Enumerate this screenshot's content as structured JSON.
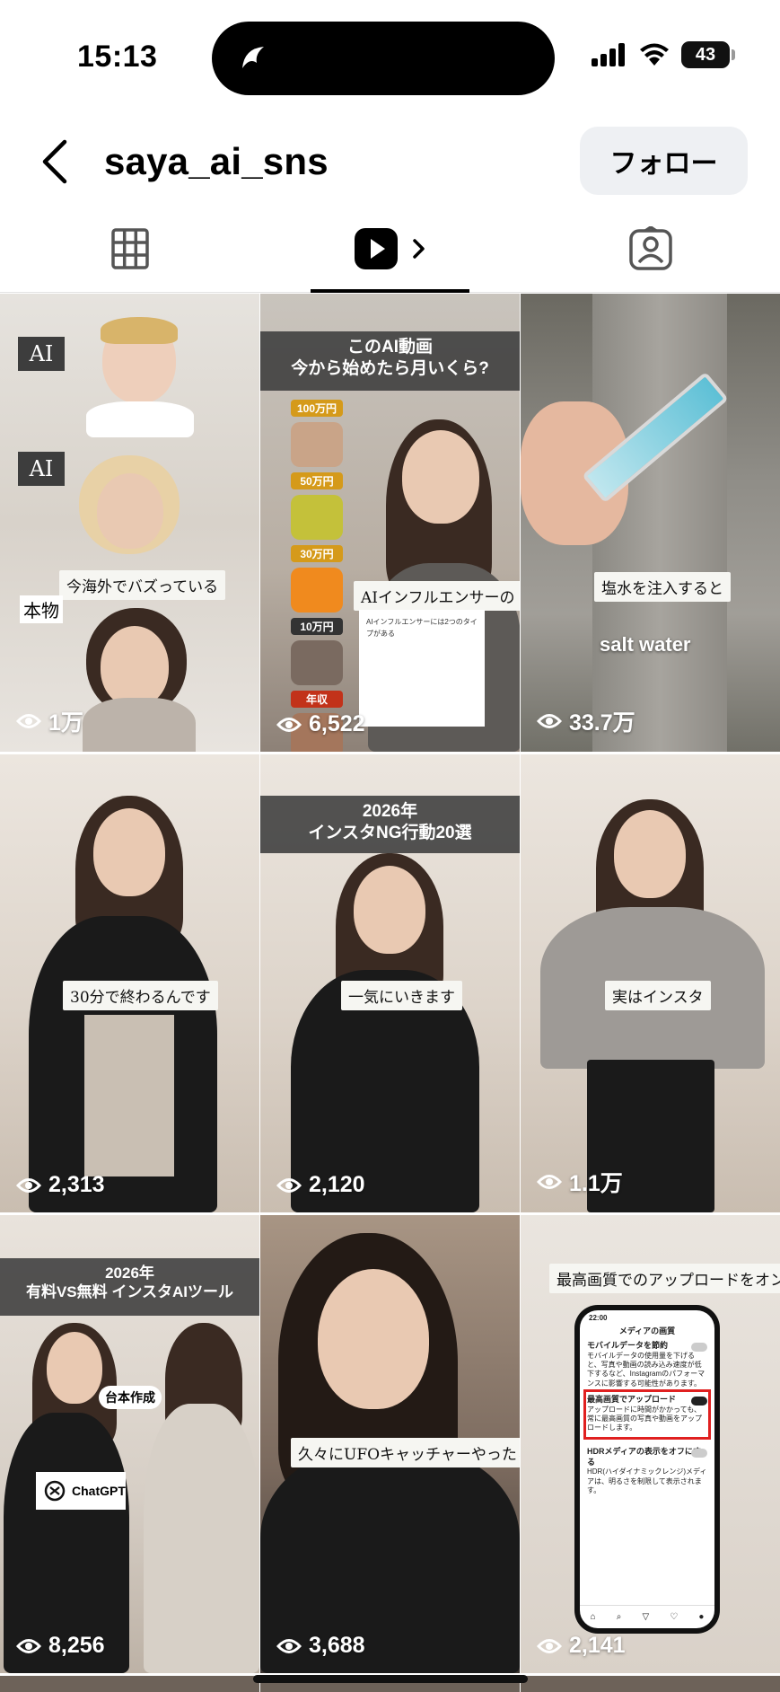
{
  "status_bar": {
    "time": "15:13",
    "battery": "43"
  },
  "header": {
    "username": "saya_ai_sns",
    "follow_label": "フォロー"
  },
  "tabs": [
    {
      "icon": "grid-icon"
    },
    {
      "icon": "reels-icon",
      "active": true
    },
    {
      "icon": "tagged-icon"
    }
  ],
  "reels": [
    {
      "views": "1万",
      "captions": [
        "今海外でバズっている",
        "本物"
      ],
      "tags": [
        "AI",
        "AI"
      ]
    },
    {
      "views": "6,522",
      "banner": "このAI動画\n今から始めたら月いくら?",
      "captions": [
        "AIインフルエンサーの"
      ],
      "labels": [
        "100万円",
        "50万円",
        "30万円",
        "10万円",
        "年収"
      ],
      "doc_text": "AIインフルエンサーには2つのタイプがある"
    },
    {
      "views": "33.7万",
      "captions": [
        "塩水を注入すると"
      ],
      "overlay": "salt water"
    },
    {
      "views": "2,313",
      "captions": [
        "30分で終わるんです"
      ]
    },
    {
      "views": "2,120",
      "banner": "2026年\nインスタNG行動20選",
      "captions": [
        "一気にいきます"
      ]
    },
    {
      "views": "1.1万",
      "captions": [
        "実はインスタ"
      ]
    },
    {
      "views": "8,256",
      "banner": "2026年\n有料VS無料 インスタAIツール",
      "captions": [
        "台本作成"
      ],
      "badge": "ChatGPT"
    },
    {
      "views": "3,688",
      "captions": [
        "久々にUFOキャッチャーやったら"
      ]
    },
    {
      "views": "2,141",
      "captions": [
        "最高画質でのアップロードをオン"
      ],
      "phone": {
        "time": "22:00",
        "title": "メディアの画質",
        "rows": [
          {
            "title": "モバイルデータを節約",
            "desc": "モバイルデータの使用量を下げると、写真や動画の読み込み速度が低下するなど、Instagramのパフォーマンスに影響する可能性があります。"
          },
          {
            "title": "最高画質でアップロード",
            "desc": "アップロードに時間がかかっても、常に最高画質の写真や動画をアップロードします。"
          },
          {
            "title": "HDRメディアの表示をオフにする",
            "desc": "HDR(ハイダイナミックレンジ)メディアは、明るさを制限して表示されます。"
          }
        ]
      }
    }
  ]
}
